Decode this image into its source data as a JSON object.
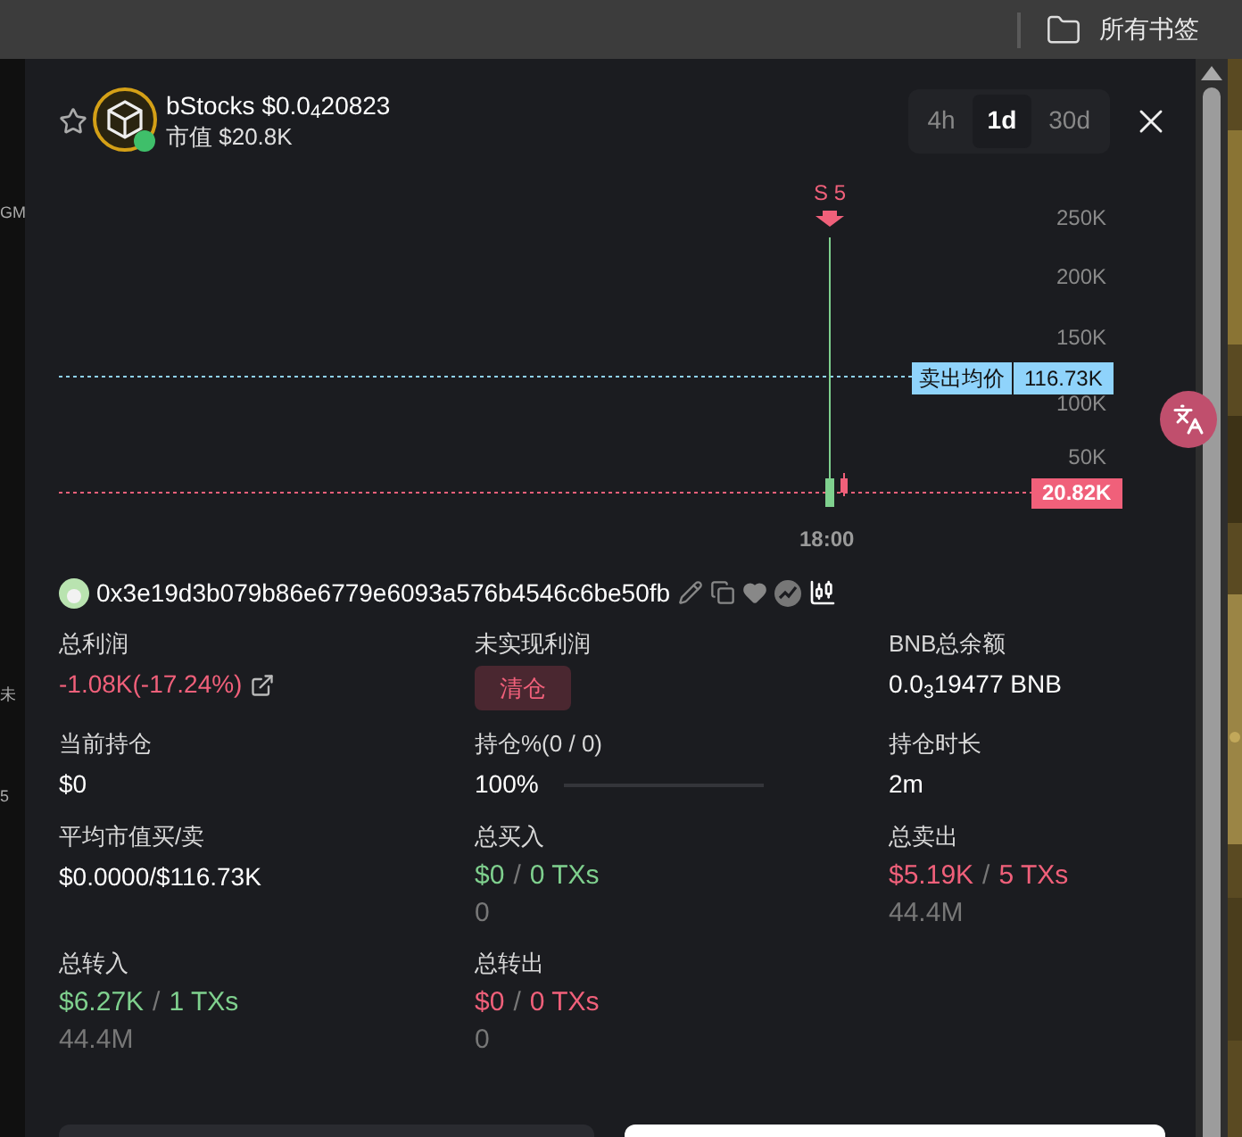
{
  "browser_bar": {
    "bookmarks_label": "所有书签"
  },
  "background_fragments": [
    "GM",
    "未",
    "5"
  ],
  "token": {
    "favorited": false,
    "title": "bStocks $0.0$_{4}$20823",
    "market_cap": "市值 $20.8K"
  },
  "timeframes": [
    {
      "label": "4h",
      "selected": false
    },
    {
      "label": "1d",
      "selected": true
    },
    {
      "label": "30d",
      "selected": false
    }
  ],
  "chart": {
    "marker": "S 5",
    "y_axis_labels": [
      "250K",
      "200K",
      "150K",
      "100K",
      "50K"
    ],
    "x_label": "18:00",
    "avg_sell_tag": {
      "label": "卖出均价",
      "value": "116.73K"
    },
    "price_tag": "20.82K"
  },
  "wallet": {
    "address": "0x3e19d3b079b86e6779e6093a576b4546c6be50fb"
  },
  "stats": [
    {
      "kind": "pnl",
      "label": "总利润",
      "value": "-1.08K(-17.24%)",
      "color": "#f0607a"
    },
    {
      "kind": "action",
      "label": "未实现利润",
      "button": "清仓"
    },
    {
      "kind": "value",
      "label": "BNB总余额",
      "value": "0.0$_{3}$19477 BNB"
    },
    {
      "kind": "value",
      "label": "当前持仓",
      "value": "$0"
    },
    {
      "kind": "progress",
      "label": "持仓%(0 / 0)",
      "value": "100%",
      "level": 0
    },
    {
      "kind": "value",
      "label": "持仓时长",
      "value": "2m"
    },
    {
      "kind": "value",
      "label": "平均市值买/卖",
      "value": "$0.0000/$116.73K"
    },
    {
      "kind": "trade",
      "label": "总买入",
      "amount": "$0",
      "separator": "/",
      "txs": "0 TXs",
      "sub": "0",
      "color": "#7fd08e"
    },
    {
      "kind": "trade",
      "label": "总卖出",
      "amount": "$5.19K",
      "separator": "/",
      "txs": "5 TXs",
      "sub": "44.4M",
      "color": "#f0607a"
    },
    {
      "kind": "trade",
      "label": "总转入",
      "amount": "$6.27K",
      "separator": "/",
      "txs": "1 TXs",
      "sub": "44.4M",
      "color": "#7fd08e"
    },
    {
      "kind": "trade",
      "label": "总转出",
      "amount": "$0",
      "separator": "/",
      "txs": "0 TXs",
      "sub": "0",
      "color": "#f0607a"
    }
  ]
}
